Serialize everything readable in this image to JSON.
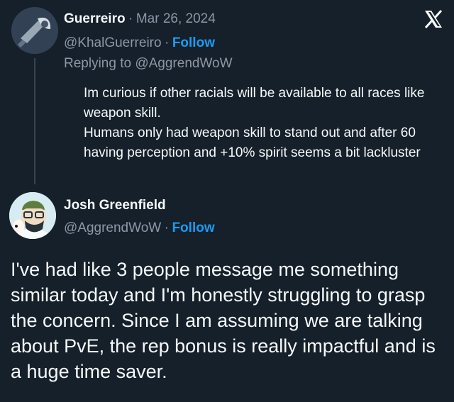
{
  "reply": {
    "name": "Guerreiro",
    "date": "Mar 26, 2024",
    "date_separator": "·",
    "handle": "@KhalGuerreiro",
    "follow_separator": "·",
    "follow_label": "Follow",
    "replying_to": "Replying to @AggrendWoW",
    "text_lines": [
      "Im curious if other racials will be available to all races like weapon skill.",
      "Humans only had weapon skill to stand out and after 60 having perception and +10% spirit seems a bit lackluster"
    ]
  },
  "main": {
    "name": "Josh Greenfield",
    "handle": "@AggrendWoW",
    "follow_separator": "·",
    "follow_label": "Follow",
    "text": "I've had like 3 people message me something similar today and I'm honestly struggling to grasp the concern. Since I am assuming we are talking about PvE, the rep bonus is really impactful and is a huge time saver."
  },
  "icons": {
    "close": "x-logo-icon"
  },
  "colors": {
    "background": "#15202b",
    "text": "#f7f9f9",
    "muted": "#8b98a5",
    "accent": "#1d9bf0"
  }
}
